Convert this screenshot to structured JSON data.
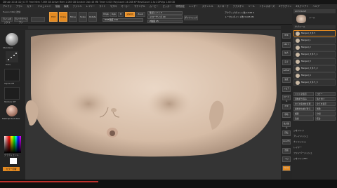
{
  "titlebar": {
    "text": "ZBrush 2024   GD_V177   Free Mem 7.069 GB   Active Mem 1.065 GB   Scratch Disk 46 MB   Timer 0.003   PolyCount 24.088 KP   MeshCount 2   Ac1 DPolys 1.68 GB"
  },
  "menu": [
    "アルファ",
    "ブラシ",
    "カラー",
    "ドキュメント",
    "描画",
    "編集",
    "ファイル",
    "レイヤー",
    "ライト",
    "マクロ",
    "マーカー",
    "マテリアル",
    "ムービー",
    "ピッカー",
    "環境設定",
    "レンダー",
    "ステンシル",
    "ストローク",
    "テクスチャ",
    "ツール",
    "トランスポーズ",
    "Zプラグイン",
    "Zスクリプト",
    "ヘルプ"
  ],
  "toolbar": {
    "breadcrumb": "Fusion 360に送信",
    "btn1": "ライトボックス",
    "btn2": "ライブブーリアン",
    "edit": "Edit",
    "draw": "Draw",
    "move": "Move",
    "scale": "Scale",
    "rotate": "Rotate",
    "mrgb": "Mrgb",
    "rgb": "Rgb",
    "m": "M",
    "zadd": "Zadd",
    "zsub": "Zsub",
    "focal_label": "焦点シフト 0",
    "draw_size_label": "ドローサイズ 20",
    "rgb_intensity": "RGB強度 100",
    "z_intensity": "Z強度 25",
    "dynamic": "ダイナミック",
    "active_points": "アクティブポイント数 2,848 K",
    "total_points": "トータルポイント数 3,045 Mil"
  },
  "left": {
    "brush": "Standard",
    "stroke": "Dots",
    "alpha": "Alpha Off",
    "texture": "Texture Off",
    "material": "MatCap Red Wax",
    "gradient": "グラディエント",
    "switch_color": "カラー切替"
  },
  "rightshelf": [
    "BPR",
    "SPix 3",
    "拡大",
    "実寸",
    "AAHalf",
    "遠近",
    "フロア",
    "ローカル",
    "XYZ",
    "移動",
    "拡大縮小",
    "回転",
    "Line Fill",
    "透過",
    "ソロ",
    "Xpose"
  ],
  "panel": {
    "header": "AUTOSAVE",
    "tool_title": "ツール",
    "subtool_title": "サブツール",
    "subtools": [
      "Merged_スタペ",
      "Merged_1",
      "Merged_2",
      "Merged_スタペ_1",
      "Merged_3",
      "Merged_スタペ_2",
      "Merged_4",
      "Merged_スタペ_3"
    ],
    "buttons_a": [
      "リスト全表示",
      "自動折り畳み",
      "全ての名前を変更",
      "最終的な並び替え",
      "複製",
      "追加"
    ],
    "buttons_b": [
      "コピー",
      "貼り付け",
      "全てを表示",
      "削除",
      "分割",
      "結合"
    ],
    "section2": [
      "ジオメトリ",
      "アレイメッシュ",
      "ナノメッシュ",
      "レイヤー",
      "ファイバーメッシュ",
      "ジオメトリHD"
    ]
  }
}
